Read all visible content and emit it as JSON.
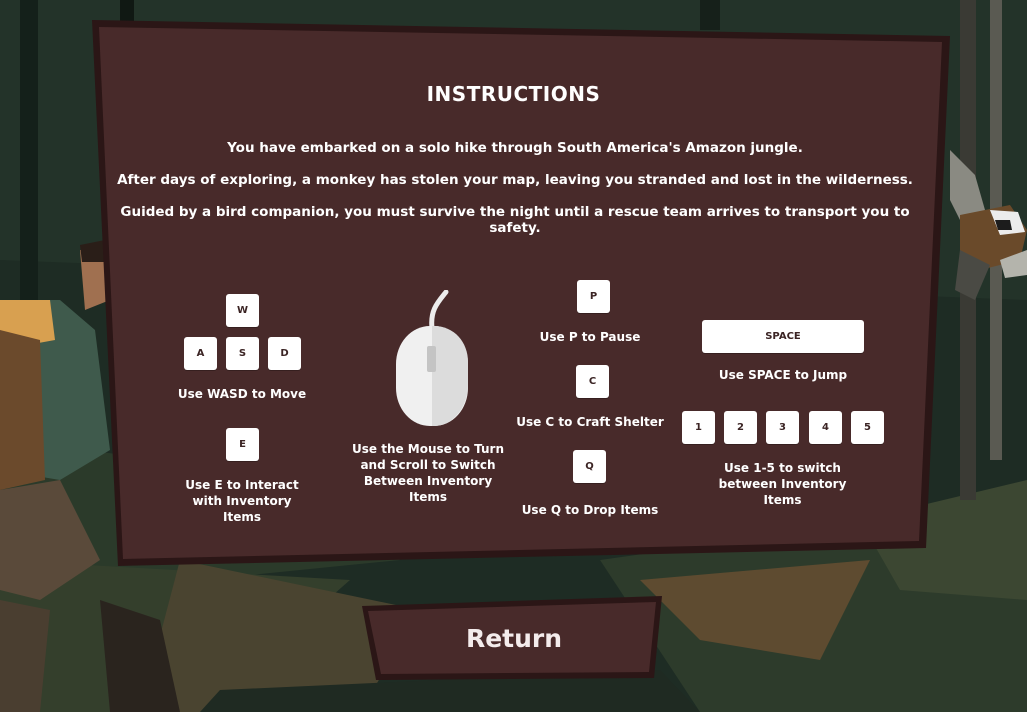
{
  "instructions": {
    "title": "INSTRUCTIONS",
    "story": [
      "You have embarked on a solo hike through South America's Amazon jungle.",
      "After days of exploring, a monkey has stolen your map, leaving you stranded and lost in the wilderness.",
      "Guided by a bird companion, you must survive the night until a rescue team arrives to transport you to safety."
    ]
  },
  "controls": {
    "move": {
      "keys": [
        "W",
        "A",
        "S",
        "D"
      ],
      "label": "Use WASD to Move"
    },
    "interact": {
      "key": "E",
      "label": "Use E to Interact with Inventory Items"
    },
    "mouse": {
      "label": "Use the Mouse to Turn and Scroll to Switch Between Inventory Items"
    },
    "pause": {
      "key": "P",
      "label": "Use P to Pause"
    },
    "craft": {
      "key": "C",
      "label": "Use C to Craft Shelter"
    },
    "drop": {
      "key": "Q",
      "label": "Use Q to Drop Items"
    },
    "jump": {
      "key": "SPACE",
      "label": "Use SPACE to Jump"
    },
    "slots": {
      "keys": [
        "1",
        "2",
        "3",
        "4",
        "5"
      ],
      "label": "Use 1-5 to switch between Inventory Items"
    }
  },
  "return_button": {
    "label": "Return"
  },
  "colors": {
    "panel": "#482a2a",
    "panel_border": "#2b1616",
    "key_bg": "#ffffff",
    "text": "#ffffff",
    "jungle_dark": "#1c2a22"
  }
}
